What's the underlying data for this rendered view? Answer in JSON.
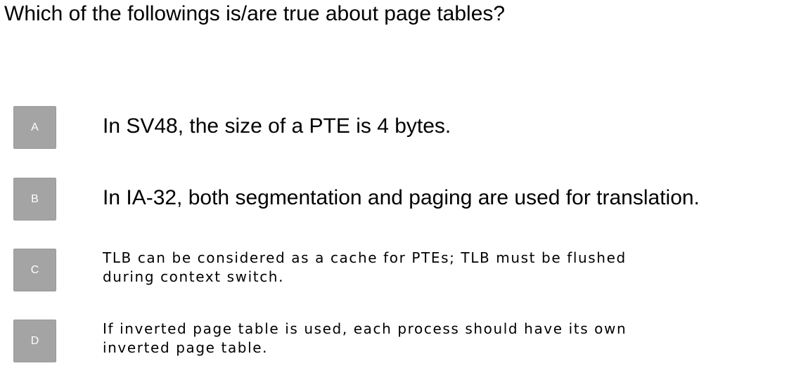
{
  "question": {
    "text": "Which of the followings is/are true about page tables?"
  },
  "options": [
    {
      "letter": "A",
      "lines": [
        "In SV48, the size of a PTE is 4 bytes."
      ]
    },
    {
      "letter": "B",
      "lines": [
        "In IA-32, both segmentation and paging are used for translation."
      ]
    },
    {
      "letter": "C",
      "lines": [
        "TLB can be considered as a cache for PTEs; TLB must be flushed",
        "during context switch."
      ]
    },
    {
      "letter": "D",
      "lines": [
        "If inverted page table is used, each process should have its own",
        "inverted page table."
      ]
    }
  ],
  "colors": {
    "badge_background": "#a4a4a4",
    "badge_text": "#ffffff",
    "text": "#000000",
    "background": "#ffffff"
  }
}
